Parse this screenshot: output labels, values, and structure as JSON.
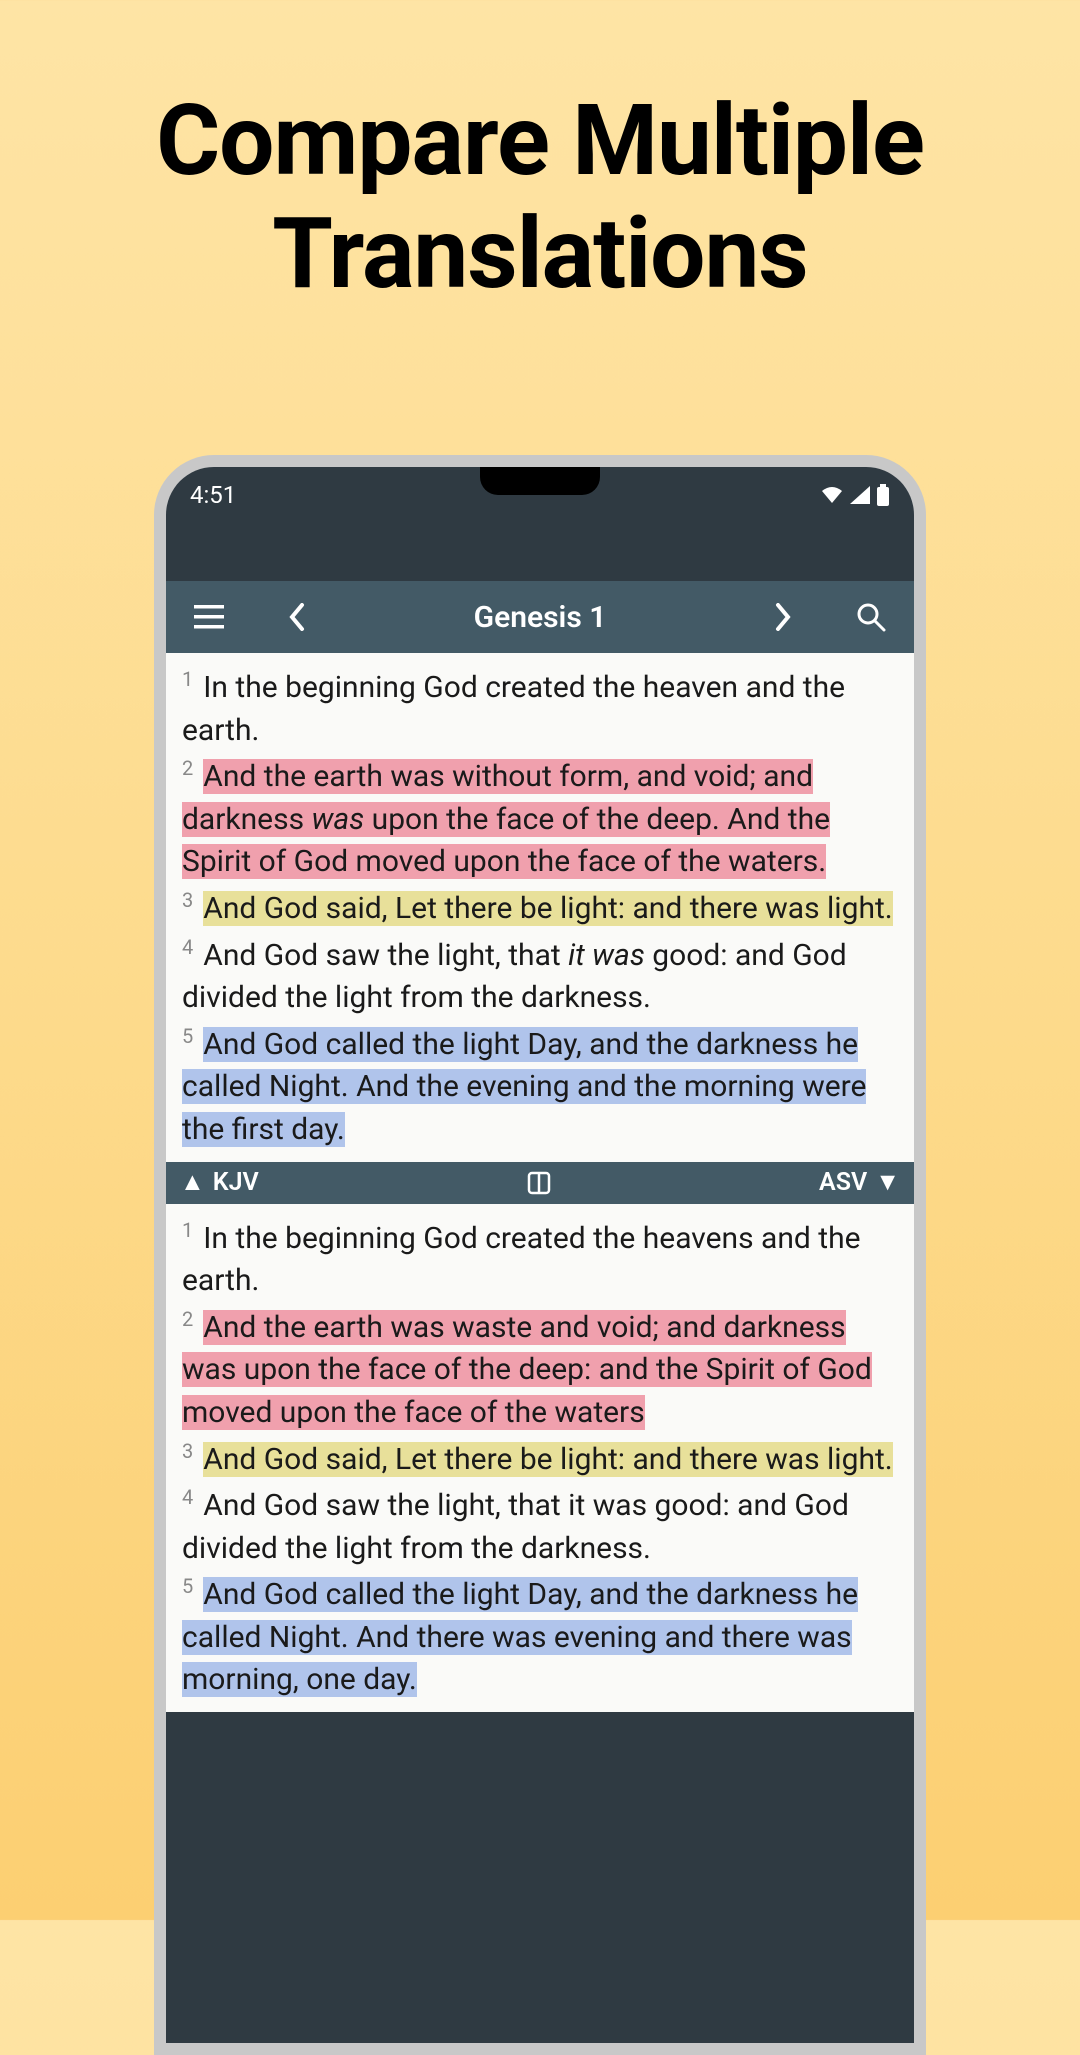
{
  "promo": {
    "title_line1": "Compare Multiple",
    "title_line2": "Translations"
  },
  "status": {
    "time": "4:51"
  },
  "toolbar": {
    "chapter": "Genesis 1"
  },
  "split": {
    "left_label": "KJV",
    "right_label": "ASV"
  },
  "pane1": {
    "v1": {
      "num": "1",
      "text": "In the beginning God created the heaven and the earth."
    },
    "v2": {
      "num": "2",
      "text": "And the earth was without form, and void; and darkness ",
      "italic": "was",
      "text2": " upon the face of the deep. And the Spirit of God moved upon the face of the waters."
    },
    "v3": {
      "num": "3",
      "text": "And God said, Let there be light: and there was light."
    },
    "v4": {
      "num": "4",
      "text_a": "And God saw the light, that ",
      "italic": "it was",
      "text_b": " good: and God divided the light from the darkness."
    },
    "v5": {
      "num": "5",
      "text": "And God called the light Day, and the darkness he called Night. And the evening and the morning were the first day."
    }
  },
  "pane2": {
    "v1": {
      "num": "1",
      "text": "In the beginning God created the heavens and the earth."
    },
    "v2": {
      "num": "2",
      "text": "And the earth was waste and void; and darkness was upon the face of the deep: and the Spirit of God moved upon the face of the waters"
    },
    "v3": {
      "num": "3",
      "text": "And God said, Let there be light: and there was light."
    },
    "v4": {
      "num": "4",
      "text": "And God saw the light, that it was good: and God divided the light from the darkness."
    },
    "v5": {
      "num": "5",
      "text": "And God called the light Day, and the darkness he called Night. And there was evening and there was morning, one day."
    }
  }
}
